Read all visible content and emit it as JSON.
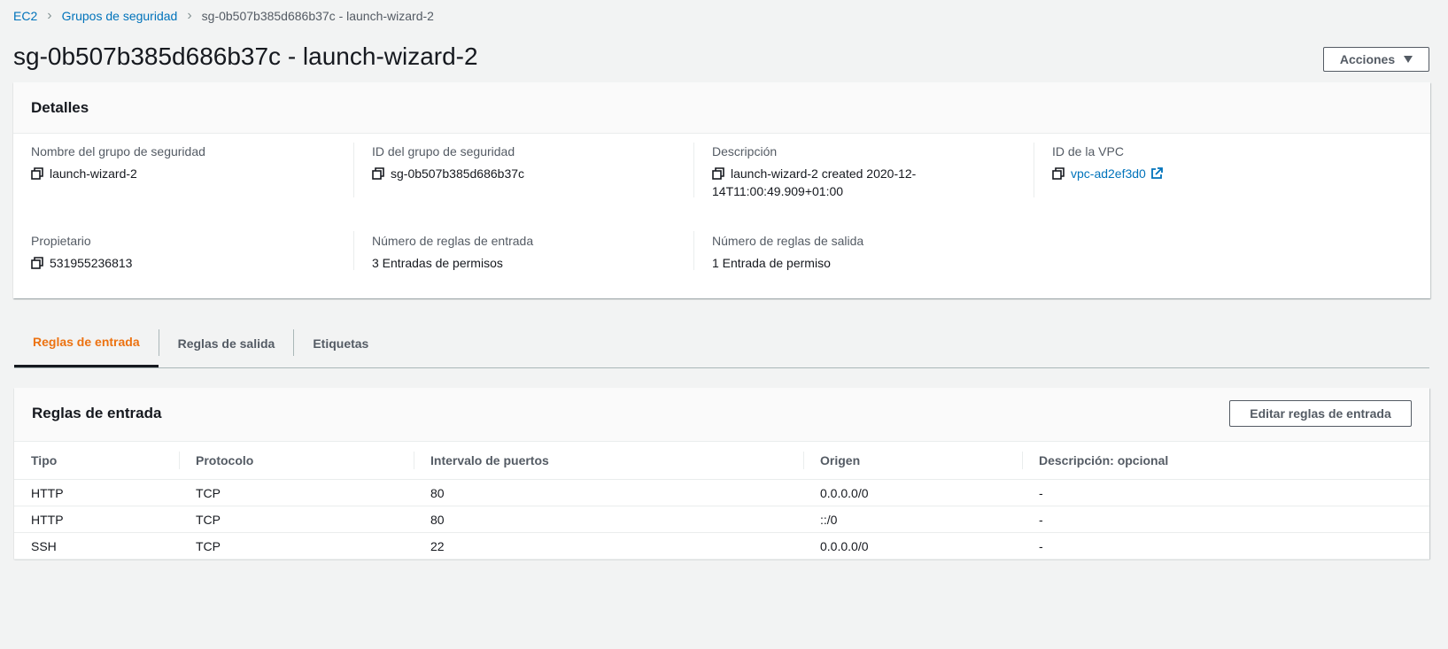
{
  "breadcrumb": {
    "items": [
      "EC2",
      "Grupos de seguridad"
    ],
    "current": "sg-0b507b385d686b37c - launch-wizard-2"
  },
  "page": {
    "title": "sg-0b507b385d686b37c - launch-wizard-2",
    "actions_label": "Acciones"
  },
  "details": {
    "header": "Detalles",
    "sg_name_label": "Nombre del grupo de seguridad",
    "sg_name": "launch-wizard-2",
    "sg_id_label": "ID del grupo de seguridad",
    "sg_id": "sg-0b507b385d686b37c",
    "description_label": "Descripción",
    "description_line1": "launch-wizard-2 created 2020-12-",
    "description_line2": "14T11:00:49.909+01:00",
    "vpc_label": "ID de la VPC",
    "vpc_id": "vpc-ad2ef3d0",
    "owner_label": "Propietario",
    "owner": "531955236813",
    "inbound_count_label": "Número de reglas de entrada",
    "inbound_count": "3 Entradas de permisos",
    "outbound_count_label": "Número de reglas de salida",
    "outbound_count": "1 Entrada de permiso"
  },
  "tabs": [
    {
      "label": "Reglas de entrada",
      "active": true
    },
    {
      "label": "Reglas de salida",
      "active": false
    },
    {
      "label": "Etiquetas",
      "active": false
    }
  ],
  "rules": {
    "header": "Reglas de entrada",
    "edit_label": "Editar reglas de entrada",
    "columns": [
      "Tipo",
      "Protocolo",
      "Intervalo de puertos",
      "Origen",
      "Descripción: opcional"
    ],
    "rows": [
      [
        "HTTP",
        "TCP",
        "80",
        "0.0.0.0/0",
        "-"
      ],
      [
        "HTTP",
        "TCP",
        "80",
        "::/0",
        "-"
      ],
      [
        "SSH",
        "TCP",
        "22",
        "0.0.0.0/0",
        "-"
      ]
    ]
  },
  "colors": {
    "link": "#0073bb",
    "active_tab": "#ec7211",
    "background": "#f2f3f3"
  }
}
